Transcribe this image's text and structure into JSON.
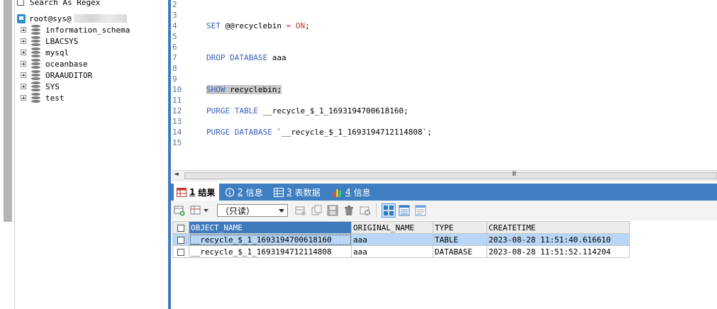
{
  "sidebar": {
    "search_as_regex": "Search As Regex",
    "connection_label": "root@sys@",
    "schemas": [
      "information_schema",
      "LBACSYS",
      "mysql",
      "oceanbase",
      "ORAAUDITOR",
      "SYS",
      "test"
    ]
  },
  "editor": {
    "line_numbers": [
      "2",
      "3",
      "4",
      "5",
      "6",
      "7",
      "8",
      "9",
      "10",
      "11",
      "12",
      "13",
      "14",
      "15"
    ],
    "line4": {
      "kw": "SET",
      "var": "@@recyclebin",
      "op": "=",
      "val": "ON",
      "end": ";"
    },
    "line7": {
      "kw": "DROP DATABASE",
      "rest": "aaa"
    },
    "line10": {
      "kw": "SHOW",
      "rest": "recyclebin;"
    },
    "line12": {
      "kw": "PURGE TABLE",
      "rest": "__recycle_$_1_1693194700618160;"
    },
    "line14": {
      "kw": "PURGE DATABASE",
      "rest": "`__recycle_$_1_1693194712114808`;"
    }
  },
  "scrollbar": {
    "left_arrow": "◄",
    "grip": "III"
  },
  "tabs": [
    {
      "num": "1",
      "label": "结果",
      "icon": "result-grid-icon"
    },
    {
      "num": "2",
      "label": "信息",
      "icon": "info-icon"
    },
    {
      "num": "3",
      "label": "表数据",
      "icon": "table-data-icon"
    },
    {
      "num": "4",
      "label": "信息",
      "icon": "chart-info-icon"
    }
  ],
  "toolbar": {
    "readonly_value": "（只读）"
  },
  "grid": {
    "columns": [
      "OBJECT_NAME",
      "ORIGINAL_NAME",
      "TYPE",
      "CREATETIME"
    ],
    "rows": [
      [
        "__recycle_$_1_1693194700618160",
        "aaa",
        "TABLE",
        "2023-08-28 11:51:40.616610"
      ],
      [
        "__recycle_$_1_1693194712114808",
        "aaa",
        "DATABASE",
        "2023-08-28 11:51:52.114204"
      ]
    ]
  },
  "colors": {
    "accent": "#3f7ec1",
    "keyword": "#3a5fb8",
    "selection": "#b8d6f5"
  }
}
